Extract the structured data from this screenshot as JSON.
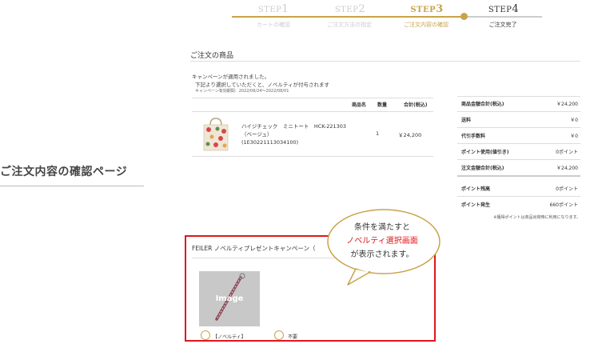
{
  "steps": [
    {
      "word": "STEP",
      "num": "1",
      "label": "カートの確認",
      "state": "done"
    },
    {
      "word": "STEP",
      "num": "2",
      "label": "ご注文方法の指定",
      "state": "done"
    },
    {
      "word": "STEP",
      "num": "3",
      "label": "ご注文内容の確認",
      "state": "current"
    },
    {
      "word": "STEP",
      "num": "4",
      "label": "ご注文完了",
      "state": "upcoming"
    }
  ],
  "page_title": "ご注文内容の確認ページ",
  "order": {
    "section_title": "ご注文の商品",
    "notice_line1": "キャンペーンが適用されました。",
    "notice_line2": "下記より選択していただくと、ノベルティが付与されます",
    "notice_period": "キャンペーン有効期間：2022/06/24〜2022/08/01",
    "headers": {
      "name": "商品名",
      "qty": "数量",
      "subtotal": "合計(税込)"
    },
    "item": {
      "name_line1": "ハイジチェック　ミニトート　HCK-221303",
      "name_line2": "（ベージュ）",
      "name_line3": "(1E30221113034100)",
      "qty": "1",
      "subtotal": "￥24,200"
    }
  },
  "summary": {
    "rows": [
      {
        "label": "商品金額合計(税込)",
        "value": "￥24,200"
      },
      {
        "label": "送料",
        "value": "￥0"
      },
      {
        "label": "代引手数料",
        "value": "￥0"
      },
      {
        "label": "ポイント使用(値引き)",
        "value": "0ポイント"
      },
      {
        "label": "注文金額合計(税込)",
        "value": "￥24,200"
      },
      {
        "label": "ポイント残高",
        "value": "0ポイント"
      },
      {
        "label": "ポイント発生",
        "value": "660ポイント"
      }
    ],
    "note": "※獲得ポイントは商品出荷時に利用になります。"
  },
  "campaign": {
    "title": "FEILER ノベルティプレゼントキャンペーン（",
    "image_placeholder": "Image",
    "option_novelty": "【ノベルティ】",
    "option_none": "不要"
  },
  "callout": {
    "line1": "条件を満たすと",
    "line2": "ノベルティ選択画面",
    "line3": "が表示されます。"
  },
  "colors": {
    "gold": "#c9a349",
    "red": "#e0161b",
    "step_done": "#c9c9c9"
  }
}
